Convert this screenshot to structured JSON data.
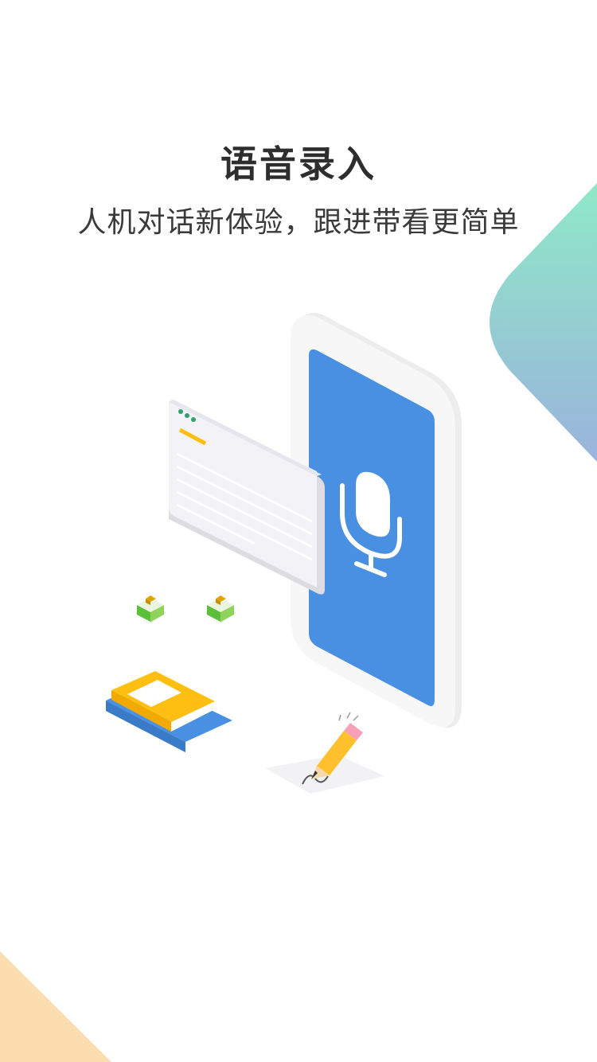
{
  "onboarding": {
    "title": "语音录入",
    "subtitle": "人机对话新体验，跟进带看更简单"
  },
  "colors": {
    "accent_blue": "#4A90E2",
    "gradient_top": "#8FE9C7",
    "gradient_bottom": "#9AB3DC",
    "corner_peach": "#FBDDB0",
    "book_yellow": "#FFBE12",
    "book_blue": "#4A90E2"
  },
  "icons": {
    "mic": "microphone-icon",
    "pencil": "pencil-icon"
  }
}
